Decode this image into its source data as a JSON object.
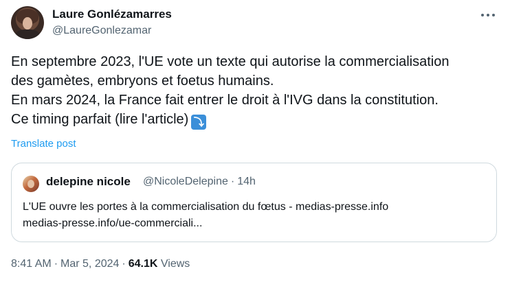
{
  "author": {
    "name": "Laure Gonlézamarres",
    "handle": "@LaureGonlezamar"
  },
  "tweet": {
    "lines": [
      "En septembre 2023, l'UE vote un texte qui autorise la commercialisation",
      "des gamètes, embryons et foetus humains.",
      "En mars 2024, la France fait entrer le droit à l'IVG dans la constitution.",
      "Ce timing parfait (lire l'article)"
    ],
    "emoji": "⤵",
    "emoji_icon": "arrow-curving-down-icon",
    "translate_label": "Translate post"
  },
  "quoted": {
    "name": "delepine nicole",
    "handle": "@NicoleDelepine",
    "separator": "·",
    "time": "14h",
    "title": "L'UE ouvre les portes à la commercialisation du fœtus - medias-presse.info",
    "link": "medias-presse.info/ue-commerciali..."
  },
  "footer": {
    "time": "8:41 AM",
    "separator": "·",
    "date": "Mar 5, 2024",
    "views_count": "64.1K",
    "views_label": "Views"
  },
  "colors": {
    "link": "#1d9bf0",
    "secondary_text": "#536471",
    "border": "#cfd9de"
  }
}
